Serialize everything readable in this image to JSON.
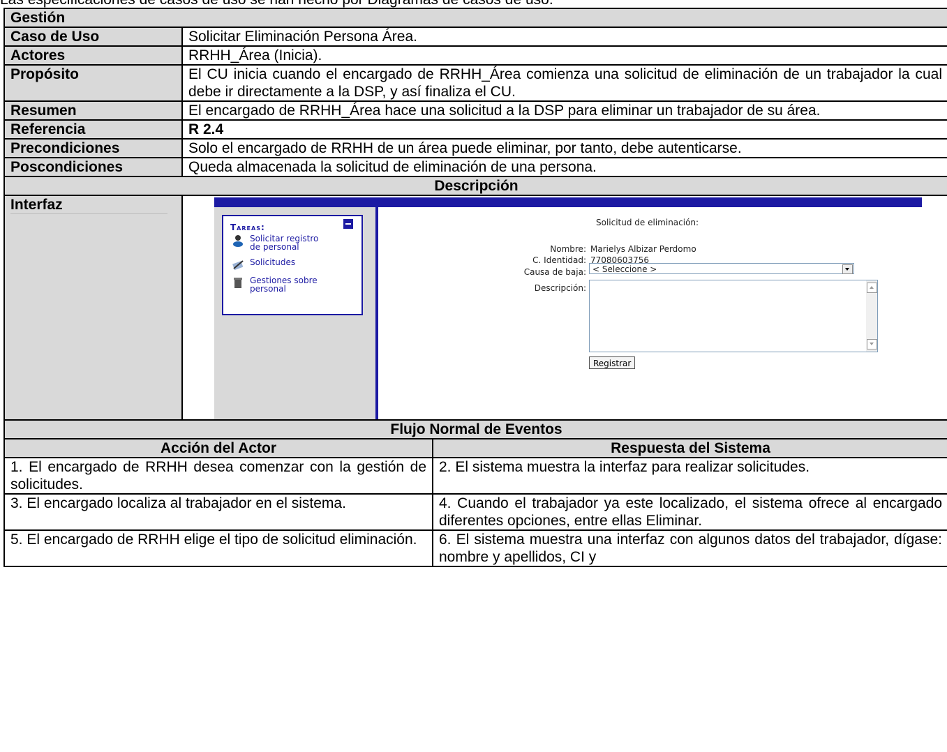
{
  "intro_text": "Las especificaciones de casos de uso se han hecho por Diagramas de casos de uso.",
  "section_title": "Gestión",
  "rows": {
    "caso_label": "Caso de Uso",
    "caso_value": "Solicitar Eliminación Persona Área.",
    "actores_label": "Actores",
    "actores_value": "RRHH_Área (Inicia).",
    "proposito_label": "Propósito",
    "proposito_value": "El CU inicia cuando el encargado de RRHH_Área comienza una solicitud de eliminación de un trabajador la cual debe ir directamente a la DSP, y así finaliza el CU.",
    "resumen_label": "Resumen",
    "resumen_value": "El encargado de RRHH_Área hace una solicitud a la DSP para eliminar un trabajador de su área.",
    "referencia_label": "Referencia",
    "referencia_value": "R 2.4",
    "precond_label": "Precondiciones",
    "precond_value": "Solo el encargado de RRHH de un área puede eliminar, por tanto, debe autenticarse.",
    "poscond_label": "Poscondiciones",
    "poscond_value": "Queda almacenada la solicitud de eliminación de una persona."
  },
  "descripcion_header": "Descripción",
  "interfaz_label": "Interfaz",
  "ui": {
    "tasks_title": "Tareas:",
    "task1": [
      "Solicitar registro",
      "de personal"
    ],
    "task2": "Solicitudes",
    "task3": [
      "Gestiones sobre",
      "personal"
    ],
    "form_title": "Solicitud de eliminación:",
    "nombre_label": "Nombre:",
    "nombre_value": "Marielys Albizar Perdomo",
    "ci_label": "C. Identidad:",
    "ci_value": "77080603756",
    "causa_label": "Causa de baja:",
    "causa_value": "< Seleccione >",
    "desc_label": "Descripción:",
    "button_label": "Registrar",
    "colors": {
      "accent": "#1c1aa3",
      "panel": "#d9d9d9"
    }
  },
  "flujo_header": "Flujo Normal de Eventos",
  "col_actor": "Acción del Actor",
  "col_sistema": "Respuesta del Sistema",
  "flujo": [
    {
      "actor": "1. El encargado de RRHH desea comenzar con la gestión de solicitudes.",
      "sistema": "2. El sistema muestra la interfaz para realizar solicitudes."
    },
    {
      "actor": "3. El encargado localiza al trabajador en el sistema.",
      "sistema": "4. Cuando el trabajador ya este localizado, el sistema ofrece al encargado diferentes opciones, entre ellas Eliminar."
    },
    {
      "actor": "5. El encargado de RRHH elige el tipo de solicitud eliminación.",
      "sistema": "6. El sistema muestra una interfaz con algunos datos del trabajador, dígase: nombre y apellidos, CI y"
    }
  ]
}
